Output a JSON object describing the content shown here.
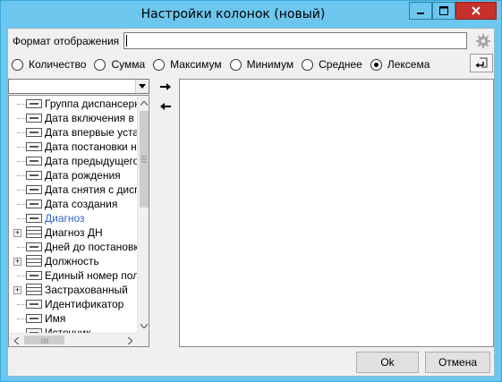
{
  "window": {
    "title": "Настройки колонок (новый)",
    "colors": {
      "frame": "#6cc6ee",
      "close": "#c7312b",
      "selected_item": "#2d63c5"
    }
  },
  "format": {
    "label": "Формат отображения",
    "value": ""
  },
  "aggregation": {
    "options": [
      {
        "label": "Количество",
        "selected": false
      },
      {
        "label": "Сумма",
        "selected": false
      },
      {
        "label": "Максимум",
        "selected": false
      },
      {
        "label": "Минимум",
        "selected": false
      },
      {
        "label": "Среднее",
        "selected": false
      },
      {
        "label": "Лексема",
        "selected": true
      }
    ]
  },
  "field_selector": {
    "value": ""
  },
  "fields": [
    {
      "label": "Группа диспансерного учёта",
      "expandable": false,
      "icon": "field-icon",
      "selected": false
    },
    {
      "label": "Дата включения в группу",
      "expandable": false,
      "icon": "field-icon",
      "selected": false
    },
    {
      "label": "Дата впервые установленного",
      "expandable": false,
      "icon": "field-icon",
      "selected": false
    },
    {
      "label": "Дата постановки на учёт",
      "expandable": false,
      "icon": "field-icon",
      "selected": false
    },
    {
      "label": "Дата предыдущего осмотра",
      "expandable": false,
      "icon": "field-icon",
      "selected": false
    },
    {
      "label": "Дата рождения",
      "expandable": false,
      "icon": "field-icon",
      "selected": false
    },
    {
      "label": "Дата снятия с диспансерного учёта",
      "expandable": false,
      "icon": "field-icon",
      "selected": false
    },
    {
      "label": "Дата создания",
      "expandable": false,
      "icon": "field-icon",
      "selected": false
    },
    {
      "label": "Диагноз",
      "expandable": false,
      "icon": "field-icon",
      "selected": true
    },
    {
      "label": "Диагноз ДН",
      "expandable": true,
      "icon": "table-icon",
      "selected": false
    },
    {
      "label": "Дней до постановки на учёт",
      "expandable": false,
      "icon": "field-icon",
      "selected": false
    },
    {
      "label": "Должность",
      "expandable": true,
      "icon": "table-icon",
      "selected": false
    },
    {
      "label": "Единый номер полиса",
      "expandable": false,
      "icon": "field-icon",
      "selected": false
    },
    {
      "label": "Застрахованный",
      "expandable": true,
      "icon": "table-icon",
      "selected": false
    },
    {
      "label": "Идентификатор",
      "expandable": false,
      "icon": "field-icon",
      "selected": false
    },
    {
      "label": "Имя",
      "expandable": false,
      "icon": "field-icon",
      "selected": false
    },
    {
      "label": "Источник",
      "expandable": false,
      "icon": "field-icon",
      "selected": false
    }
  ],
  "buttons": {
    "ok": "Ok",
    "cancel": "Отмена"
  }
}
